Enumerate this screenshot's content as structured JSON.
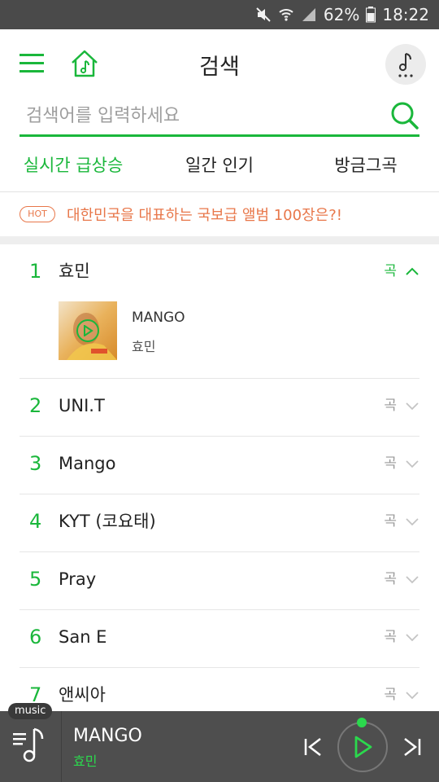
{
  "status_bar": {
    "battery": "62%",
    "time": "18:22"
  },
  "header": {
    "title": "검색"
  },
  "search": {
    "placeholder": "검색어를 입력하세요"
  },
  "tabs": [
    {
      "label": "실시간 급상승"
    },
    {
      "label": "일간 인기"
    },
    {
      "label": "방금그곡"
    }
  ],
  "hot_banner": {
    "badge": "HOT",
    "text": "대한민국을 대표하는 국보급 앨범 100장은?!"
  },
  "chart": {
    "rows": [
      {
        "rank": "1",
        "artist": "효민",
        "type": "곡",
        "expanded": true,
        "song": {
          "title": "MANGO",
          "artist": "효민"
        }
      },
      {
        "rank": "2",
        "artist": "UNI.T",
        "type": "곡"
      },
      {
        "rank": "3",
        "artist": "Mango",
        "type": "곡"
      },
      {
        "rank": "4",
        "artist": "KYT (코요태)",
        "type": "곡"
      },
      {
        "rank": "5",
        "artist": "Pray",
        "type": "곡"
      },
      {
        "rank": "6",
        "artist": "San E",
        "type": "곡"
      },
      {
        "rank": "7",
        "artist": "앤씨아",
        "type": "곡"
      }
    ]
  },
  "player": {
    "badge": "music",
    "title": "MANGO",
    "artist": "효민"
  },
  "colors": {
    "accent": "#1ab73b",
    "hot": "#e8774a",
    "player_bg": "#4e4e4e"
  }
}
